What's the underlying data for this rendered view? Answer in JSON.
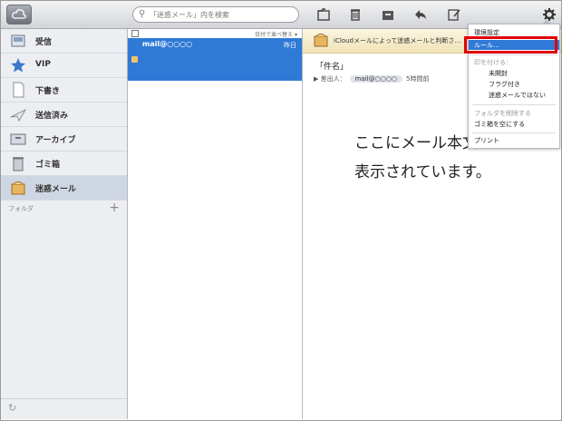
{
  "toolbar": {
    "search_placeholder": "「迷惑メール」内を検索",
    "icons": [
      "cloud-icon",
      "move-to-folder-icon",
      "trash-icon",
      "archive-icon",
      "reply-icon",
      "compose-icon",
      "gear-icon"
    ]
  },
  "sidebar": {
    "items": [
      {
        "label": "受信",
        "icon": "inbox-icon"
      },
      {
        "label": "VIP",
        "icon": "star-icon"
      },
      {
        "label": "下書き",
        "icon": "draft-icon"
      },
      {
        "label": "送信済み",
        "icon": "sent-icon"
      },
      {
        "label": "アーカイブ",
        "icon": "archive-icon"
      },
      {
        "label": "ゴミ箱",
        "icon": "trash-icon"
      },
      {
        "label": "迷惑メール",
        "icon": "junk-icon",
        "selected": true
      }
    ],
    "folders_label": "フォルダ",
    "add_label": "+"
  },
  "message_list": {
    "sort_label": "日付で並べ替え ▾",
    "messages": [
      {
        "from": "mail@○○○○",
        "date": "昨日"
      }
    ]
  },
  "reading_pane": {
    "banner": "iCloudメールによって迷惑メールと判断さ…",
    "subject": "「件名」",
    "sender_prefix": "▶ 差出人：",
    "sender": "mail@○○○○",
    "time": "5時間前",
    "body_line1": "ここにメール本文",
    "body_line2": "表示されています。"
  },
  "menu": {
    "title": "環境設定",
    "rules": "ルール...",
    "flag_header": "印を付ける:",
    "unread": "未開封",
    "flagged": "フラグ付き",
    "not_junk": "迷惑メールではない",
    "delete_folder": "フォルダを削除する",
    "empty_trash": "ゴミ箱を空にする",
    "print": "プリント"
  },
  "colors": {
    "selection": "#2f7ad6",
    "highlight_box": "#e00000"
  }
}
